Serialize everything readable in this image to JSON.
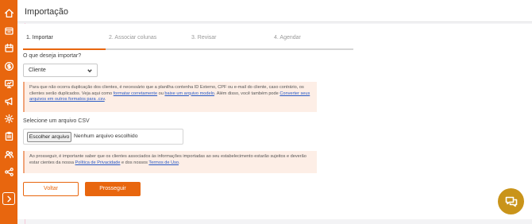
{
  "page": {
    "title": "Importação"
  },
  "steps": [
    {
      "label": "1. Importar",
      "active": true
    },
    {
      "label": "2. Associar colunas",
      "active": false
    },
    {
      "label": "3. Revisar",
      "active": false
    },
    {
      "label": "4. Agendar",
      "active": false
    }
  ],
  "import_type": {
    "question": "O que deseja importar?",
    "selected": "Cliente"
  },
  "info_alert": {
    "text_1": "Para que não ocorra duplicação dos clientes, é necessário que a planilha contenha ID Externo, CPF ou e-mail do cliente, caso contrário, os clientes serão duplicados. Veja aqui como ",
    "link_1": "formatar corretamente",
    "text_2": " ou ",
    "link_2": "baixe um arquivo modelo",
    "text_3": ". Além disso, você também pode ",
    "link_3": "Converter seus arquivos em outros formatos para .csv",
    "text_4": "."
  },
  "file_upload": {
    "label": "Selecione um arquivo CSV",
    "button": "Escolher arquivo",
    "status": "Nenhum arquivo escolhido"
  },
  "privacy_alert": {
    "text_1": "Ao prosseguir, é importante saber que os clientes associados às informações importadas ao seu estabelecimento estarão sujeitos e deverão estar cientes da nossa ",
    "link_1": "Política de Privacidade",
    "text_2": " e dos nossos ",
    "link_2": "Termos de Uso",
    "text_3": "."
  },
  "actions": {
    "back": "Voltar",
    "next": "Prosseguir"
  },
  "colors": {
    "accent": "#e8660e",
    "alert_bg": "#fdeee6",
    "link": "#2859c5",
    "chat_fab": "#c9941a"
  },
  "icons": {
    "sidebar": [
      "home-icon",
      "store-icon",
      "calendar-icon",
      "dollar-icon",
      "presentation-icon",
      "megaphone-icon",
      "gear-icon",
      "clipboard-icon",
      "users-icon",
      "share-icon"
    ],
    "expand": "chevron-right-icon",
    "chat": "chat-icon"
  }
}
